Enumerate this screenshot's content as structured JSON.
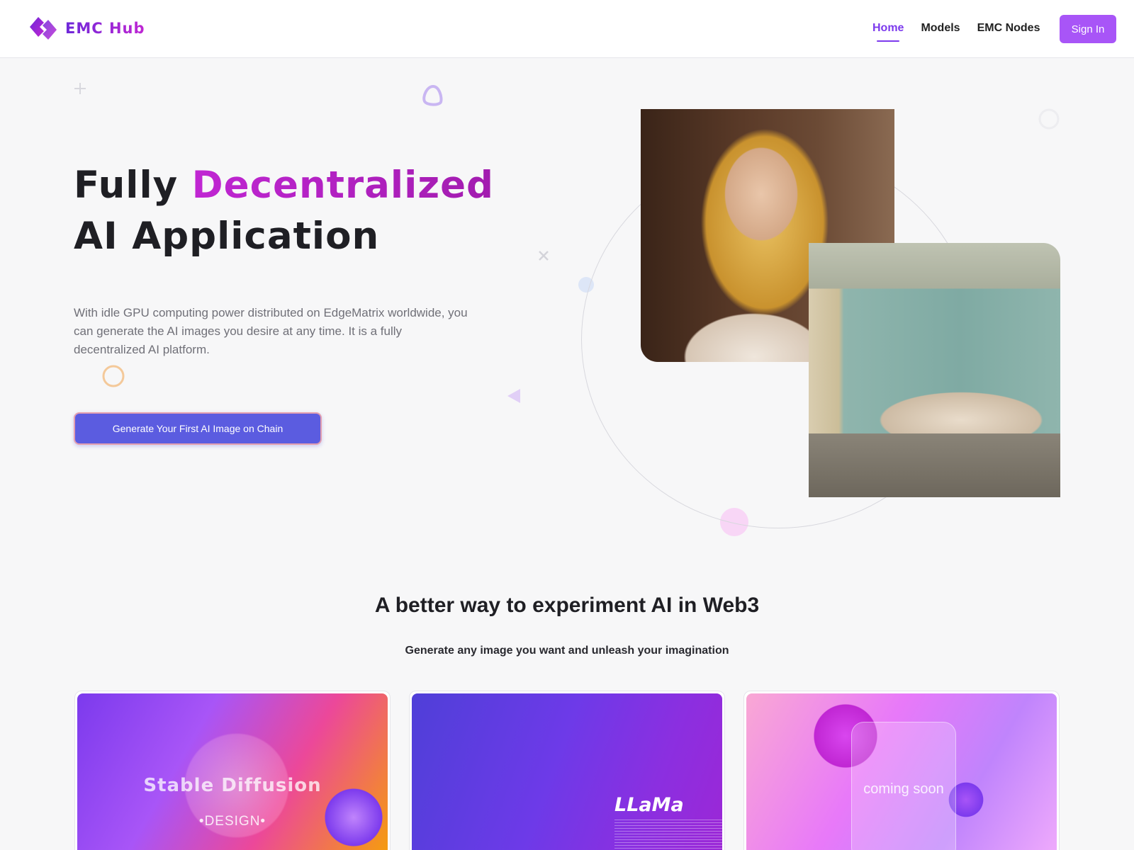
{
  "header": {
    "brand": "EMC Hub",
    "nav": [
      {
        "label": "Home",
        "active": true
      },
      {
        "label": "Models",
        "active": false
      },
      {
        "label": "EMC Nodes",
        "active": false
      }
    ],
    "sign_in_label": "Sign In"
  },
  "hero": {
    "title_part1": "Fully ",
    "title_accent": "Decentralized",
    "title_part2": " AI Application",
    "description": "With idle GPU computing power distributed on EdgeMatrix worldwide, you can generate the AI images you desire at any time. It is a fully decentralized AI platform.",
    "cta_label": "Generate Your First AI Image on Chain"
  },
  "section": {
    "title": "A better way to experiment AI in Web3",
    "subtitle": "Generate any image you want and unleash your imagination"
  },
  "cards": [
    {
      "title": "Stable Diffusion",
      "subtitle": "•DESIGN•"
    },
    {
      "title": "LLaMa"
    },
    {
      "title": "coming soon"
    }
  ],
  "colors": {
    "brand": "#7c3aed",
    "accent": "#c026d3",
    "cta": "#5b5ce0",
    "sign_in": "#a855f7"
  }
}
